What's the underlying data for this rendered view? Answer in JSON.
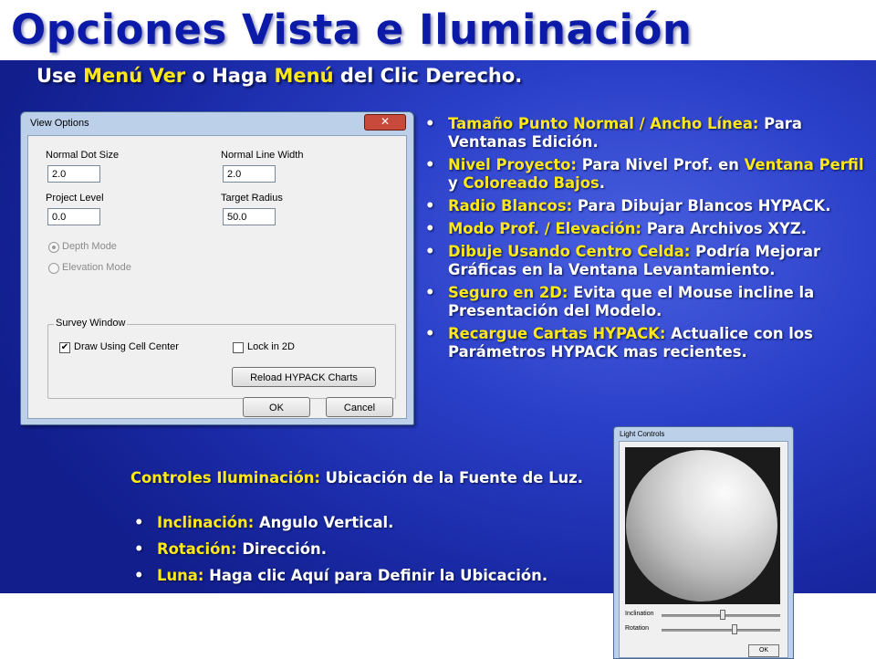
{
  "title": "Opciones Vista e Iluminación",
  "subtitle": {
    "p1": "Use ",
    "h1": "Menú Ver",
    "p2": " o Haga ",
    "h2": "Menú",
    "p3": " del Clic Derecho."
  },
  "colors": {
    "title": "#0c1aa8",
    "highlight": "#ffe81a",
    "panel": "#2a3fc8"
  },
  "view_options": {
    "title": "View Options",
    "close": "✕",
    "normal_dot_size_label": "Normal Dot Size",
    "normal_dot_size_value": "2.0",
    "normal_line_width_label": "Normal Line Width",
    "normal_line_width_value": "2.0",
    "project_level_label": "Project Level",
    "project_level_value": "0.0",
    "target_radius_label": "Target Radius",
    "target_radius_value": "50.0",
    "depth_mode_label": "Depth Mode",
    "elevation_mode_label": "Elevation Mode",
    "survey_window_label": "Survey Window",
    "draw_cell_center_label": "Draw Using Cell Center",
    "draw_cell_center_checked": "✔",
    "lock_2d_label": "Lock in 2D",
    "reload_button": "Reload HYPACK Charts",
    "ok_button": "OK",
    "cancel_button": "Cancel"
  },
  "right_bullets": [
    {
      "hl": "Tamaño Punto Normal / Ancho Línea:",
      "text": " Para Ventanas Edición."
    },
    {
      "hl": "Nivel Proyecto:",
      "t1": " Para Nivel Prof. en ",
      "hl2": "Ventana Perfil",
      "t2": " y ",
      "hl3": "Coloreado Bajos",
      "t3": "."
    },
    {
      "hl": "Radio Blancos:",
      "text": " Para Dibujar Blancos HYPACK."
    },
    {
      "hl": "Modo Prof. / Elevación:",
      "text": " Para Archivos XYZ."
    },
    {
      "hl": "Dibuje Usando Centro Celda:",
      "text": " Podría Mejorar Gráficas en la Ventana Levantamiento."
    },
    {
      "hl": "Seguro en 2D:",
      "text": " Evita que el Mouse incline la Presentación del Modelo."
    },
    {
      "hl": "Recargue Cartas HYPACK:",
      "text": " Actualice con los Parámetros HYPACK mas recientes."
    }
  ],
  "light_intro": {
    "hl": "Controles Iluminación:",
    "text": " Ubicación de la Fuente de Luz."
  },
  "light_bullets": [
    {
      "hl": "Inclinación:",
      "text": " Angulo Vertical."
    },
    {
      "hl": "Rotación:",
      "text": " Dirección."
    },
    {
      "hl": "Luna:",
      "text": " Haga clic Aquí para Definir la Ubicación."
    }
  ],
  "bullet_glyph": "•",
  "light_controls": {
    "title": "Light Controls",
    "inclination_label": "Inclination",
    "rotation_label": "Rotation",
    "ok_button": "OK"
  }
}
